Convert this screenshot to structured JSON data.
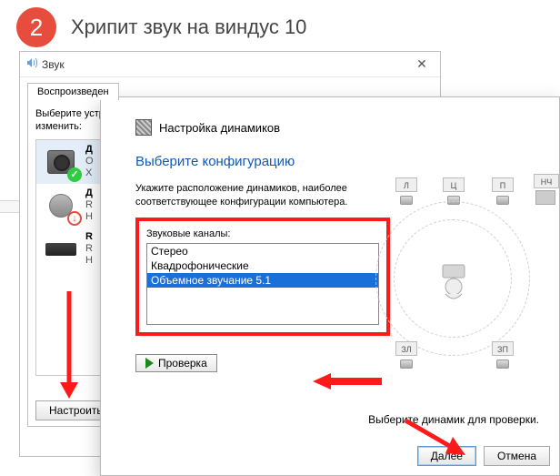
{
  "page": {
    "badge": "2",
    "title": "Хрипит звук на виндус 10"
  },
  "sound_window": {
    "title": "Звук",
    "tab_playback": "Воспроизведен",
    "instruction_line1": "Выберите устр",
    "instruction_line2": "изменить:",
    "devices": [
      {
        "l1": "Д",
        "l2": "O",
        "l3": "Х",
        "status": "ok"
      },
      {
        "l1": "Д",
        "l2": "R",
        "l3": "Н",
        "status": "err"
      },
      {
        "l1": "R",
        "l2": "R",
        "l3": "Н",
        "status": "none"
      }
    ],
    "configure_btn": "Настроить"
  },
  "setup_dialog": {
    "title": "Настройка динамиков",
    "heading": "Выберите конфигурацию",
    "sub_line1": "Укажите расположение динамиков, наиболее",
    "sub_line2": "соответствующее конфигурации компьютера.",
    "channels_label": "Звуковые каналы:",
    "channels": [
      {
        "label": "Стерео",
        "selected": false
      },
      {
        "label": "Квадрофонические",
        "selected": false
      },
      {
        "label": "Объемное звучание 5.1",
        "selected": true
      }
    ],
    "test_btn": "Проверка",
    "spk_labels": {
      "fl": "Л",
      "c": "Ц",
      "fr": "П",
      "sub": "НЧ",
      "rl": "ЗЛ",
      "rr": "ЗП"
    },
    "footline": "Выберите динамик для проверки.",
    "next_btn": "Далее",
    "cancel_btn": "Отмена"
  }
}
